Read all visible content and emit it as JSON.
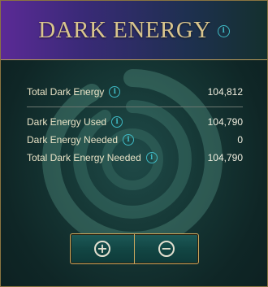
{
  "header": {
    "title": "DARK ENERGY",
    "info_icon": "i"
  },
  "stats": {
    "total": {
      "label": "Total Dark Energy",
      "value": "104,812"
    },
    "used": {
      "label": "Dark Energy Used",
      "value": "104,790"
    },
    "needed": {
      "label": "Dark Energy Needed",
      "value": "0"
    },
    "total_needed": {
      "label": "Total Dark Energy Needed",
      "value": "104,790"
    }
  },
  "buttons": {
    "increase_glyph": "+",
    "decrease_glyph": "−"
  },
  "icons": {
    "info": "info-icon",
    "plus": "plus-circle-icon",
    "minus": "minus-circle-icon",
    "background": "swirl-emblem-icon"
  },
  "colors": {
    "accent_gold": "#d9c58e",
    "info_teal": "#3fb9c4",
    "header_purple": "#5b2a96"
  }
}
